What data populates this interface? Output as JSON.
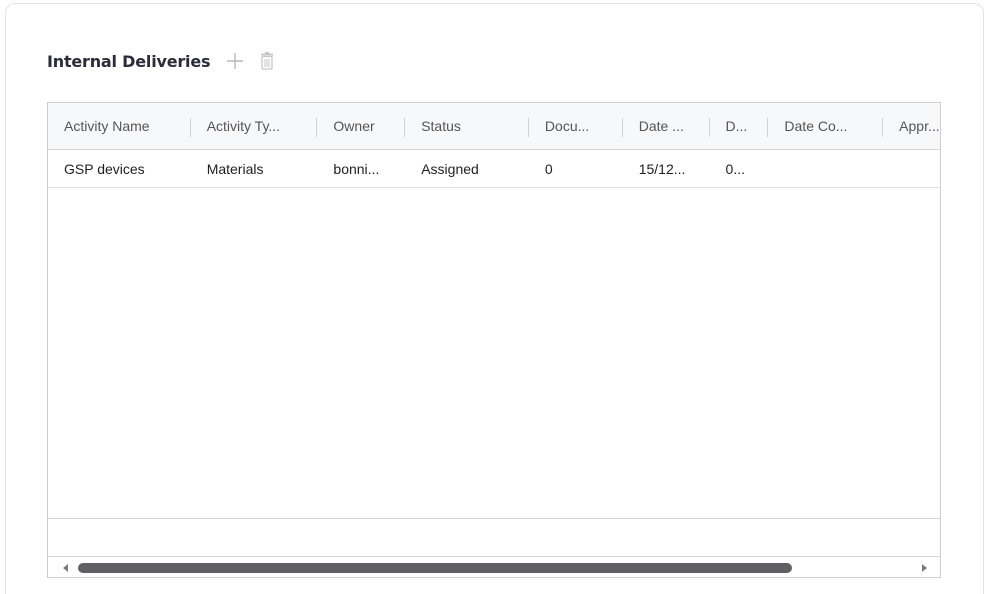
{
  "section": {
    "title": "Internal Deliveries",
    "add_icon": "plus-icon",
    "delete_icon": "trash-icon"
  },
  "table": {
    "columns": [
      {
        "label": "Activity Name"
      },
      {
        "label": "Activity Ty..."
      },
      {
        "label": "Owner"
      },
      {
        "label": "Status"
      },
      {
        "label": "Docu..."
      },
      {
        "label": "Date ..."
      },
      {
        "label": "D..."
      },
      {
        "label": "Date Co..."
      },
      {
        "label": "Appr..."
      }
    ],
    "rows": [
      {
        "cells": [
          "GSP devices",
          "Materials",
          "bonni...",
          "Assigned",
          "0",
          "15/12...",
          "0...",
          "",
          ""
        ]
      }
    ]
  },
  "scrollbar": {
    "left_icon": "arrow-left-icon",
    "right_icon": "arrow-right-icon"
  }
}
